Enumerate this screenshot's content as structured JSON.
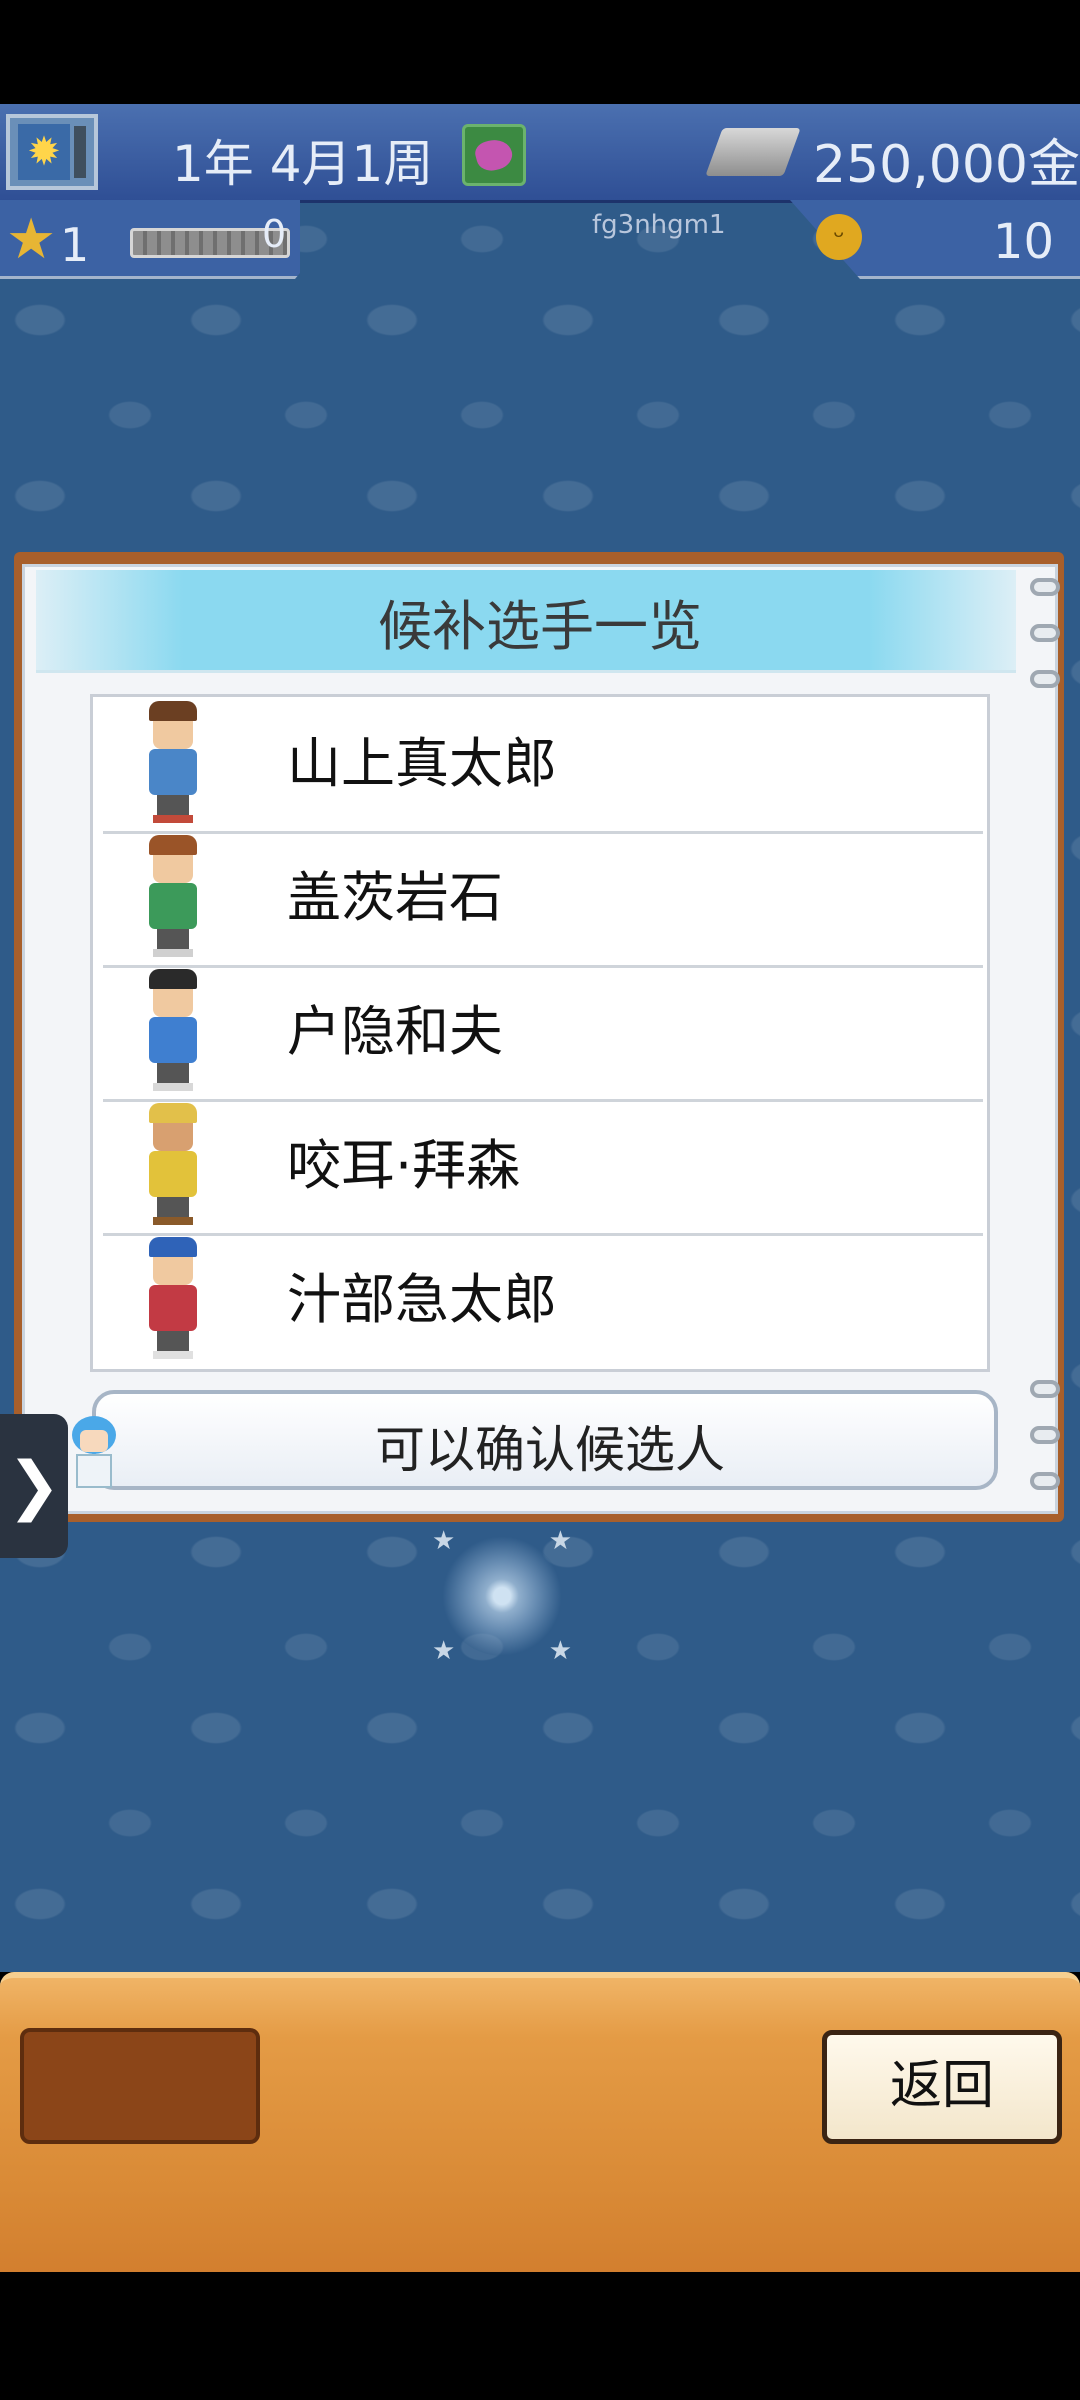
{
  "hud": {
    "date": "1年 4月1周",
    "money": "250,000金",
    "level": "1",
    "exp": "0",
    "user_id": "fg3nhgm1",
    "fans": "10"
  },
  "panel": {
    "title": "候补选手一览",
    "candidates": [
      {
        "name": "山上真太郎",
        "hair": "#6b3f22",
        "skin": "#f0c9a0",
        "shirt": "#4a86c8",
        "shoes": "#c24a3a"
      },
      {
        "name": "盖茨岩石",
        "hair": "#9a5428",
        "skin": "#f0c9a0",
        "shirt": "#3c9a5a",
        "shoes": "#d0d0d0"
      },
      {
        "name": "户隐和夫",
        "hair": "#2a2a2a",
        "skin": "#f0c9a0",
        "shirt": "#3f7fd0",
        "shoes": "#d8d8d8"
      },
      {
        "name": "咬耳·拜森",
        "hair": "#e2c04a",
        "skin": "#d8a070",
        "shirt": "#e2c23a",
        "shoes": "#8a5a2a"
      },
      {
        "name": "汁部急太郎",
        "hair": "#2f63b8",
        "skin": "#f0c9a0",
        "shirt": "#c23a44",
        "shoes": "#e0e0e0"
      }
    ],
    "confirm_label": "可以确认候选人"
  },
  "side_tab": {
    "glyph": "❯"
  },
  "bottom": {
    "back_label": "返回"
  }
}
